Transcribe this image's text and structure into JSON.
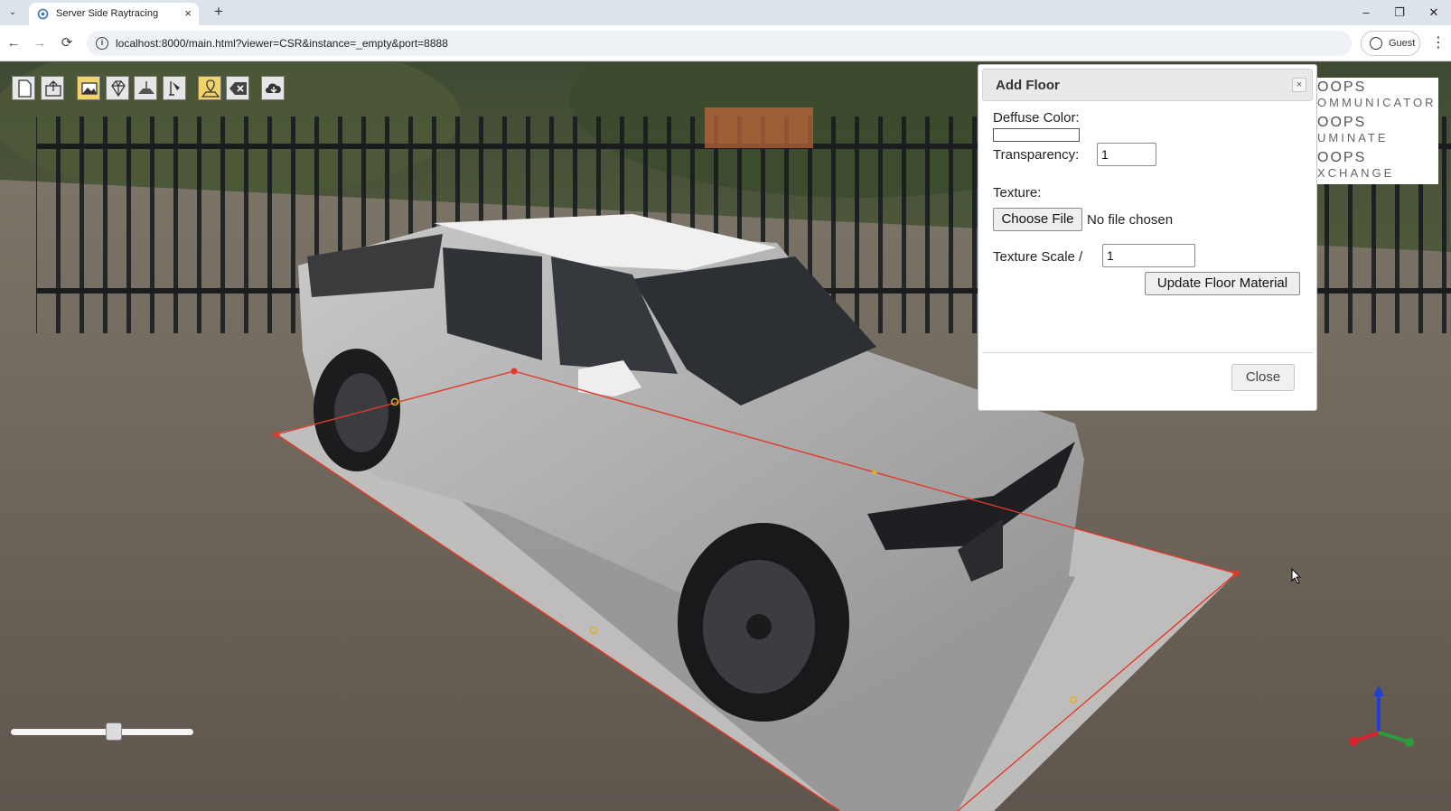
{
  "browser": {
    "tab_title": "Server Side Raytracing",
    "tab_close": "×",
    "new_tab": "+",
    "url": "localhost:8000/main.html?viewer=CSR&instance=_empty&port=8888",
    "profile_label": "Guest",
    "window_controls": {
      "minimize": "–",
      "restore": "❐",
      "close": "✕"
    },
    "nav": {
      "back": "←",
      "forward": "→",
      "reload": "⟳",
      "menu": "⋮",
      "tab_list": "⌄"
    }
  },
  "toolbar": {
    "buttons": [
      {
        "icon": "new-document-icon",
        "highlighted": false
      },
      {
        "icon": "upload-model-icon",
        "highlighted": false
      },
      {
        "icon": "environment-image-icon",
        "highlighted": true
      },
      {
        "icon": "diamond-material-icon",
        "highlighted": false
      },
      {
        "icon": "add-floor-icon",
        "highlighted": false
      },
      {
        "icon": "light-icon",
        "highlighted": false
      },
      {
        "icon": "location-marker-icon",
        "highlighted": true
      },
      {
        "icon": "delete-icon",
        "highlighted": false
      },
      {
        "icon": "cloud-download-icon",
        "highlighted": false
      }
    ]
  },
  "logos": [
    {
      "main": "OOPS",
      "sub": "OMMUNICATOR"
    },
    {
      "main": "OOPS",
      "sub": "UMINATE"
    },
    {
      "main": "OOPS",
      "sub": "XCHANGE"
    }
  ],
  "dialog": {
    "title": "Add Floor",
    "close_x": "×",
    "diffuse_label": "Deffuse Color:",
    "diffuse_color": "#ffffff",
    "transparency_label": "Transparency:",
    "transparency_value": "1",
    "texture_label": "Texture:",
    "choose_file_label": "Choose File",
    "no_file_text": "No file chosen",
    "texture_scale_label": "Texture Scale /",
    "texture_scale_value": "1",
    "update_button": "Update Floor Material",
    "close_button": "Close"
  },
  "slider": {
    "value": 0.57
  },
  "colors": {
    "accent_highlight": "#f0d36a",
    "floor_outline": "#e23a2a",
    "axis_x": "#d8232a",
    "axis_y": "#2c9c3a",
    "axis_z": "#1f3fd6"
  }
}
